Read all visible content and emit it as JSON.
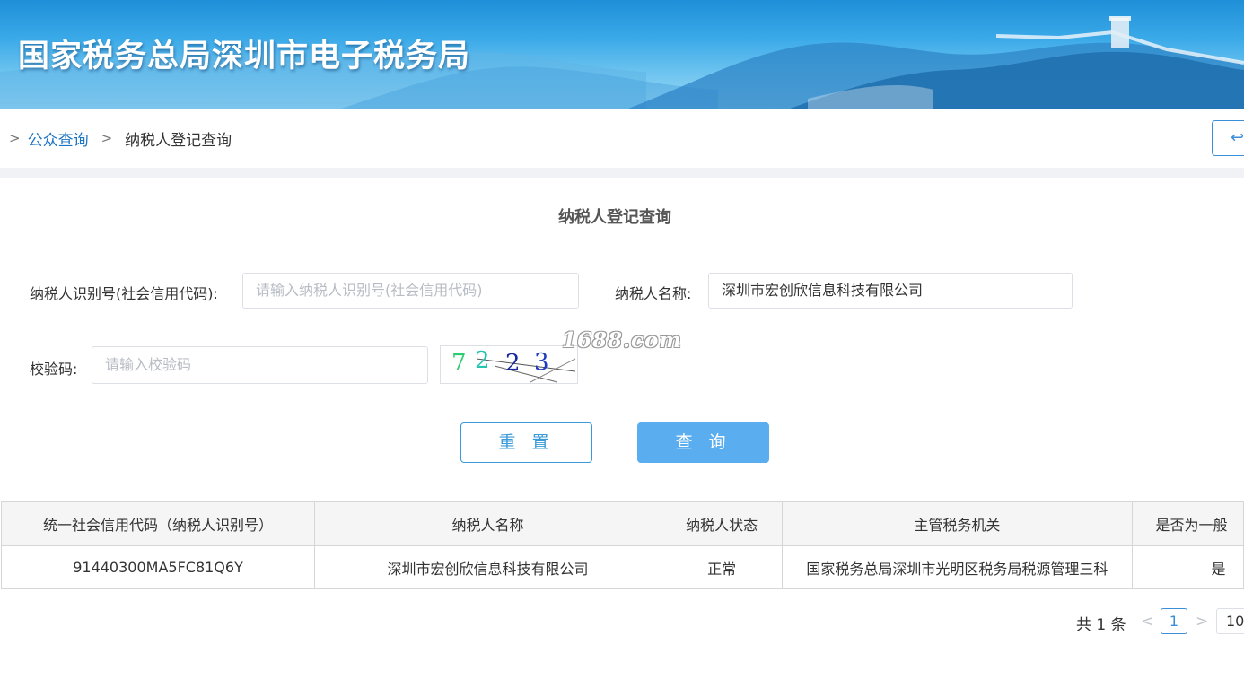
{
  "header": {
    "title": "国家税务总局深圳市电子税务局"
  },
  "breadcrumb": {
    "sep": ">",
    "link": "公众查询",
    "current": "纳税人登记查询"
  },
  "form": {
    "title": "纳税人登记查询",
    "taxid_label": "纳税人识别号(社会信用代码):",
    "taxid_placeholder": "请输入纳税人识别号(社会信用代码)",
    "name_label": "纳税人名称:",
    "name_value": "深圳市宏创欣信息科技有限公司",
    "captcha_label": "校验码:",
    "captcha_placeholder": "请输入校验码",
    "captcha_chars": [
      "7",
      "2",
      "2",
      "3"
    ],
    "watermark": "1688.com",
    "reset_label": "重 置",
    "query_label": "查 询"
  },
  "table": {
    "headers": [
      "统一社会信用代码（纳税人识别号）",
      "纳税人名称",
      "纳税人状态",
      "主管税务机关",
      "是否为一般"
    ],
    "rows": [
      [
        "91440300MA5FC81Q6Y",
        "深圳市宏创欣信息科技有限公司",
        "正常",
        "国家税务总局深圳市光明区税务局税源管理三科",
        "是"
      ]
    ]
  },
  "pagination": {
    "total": "共 1 条",
    "prev": "<",
    "page": "1",
    "next": ">",
    "page_size": "10"
  },
  "colors": {
    "accent": "#3a8fd8",
    "primary_button": "#5aaef0"
  },
  "icons": {
    "back": "return-arrow-icon",
    "prev": "chevron-left-icon",
    "next": "chevron-right-icon"
  }
}
